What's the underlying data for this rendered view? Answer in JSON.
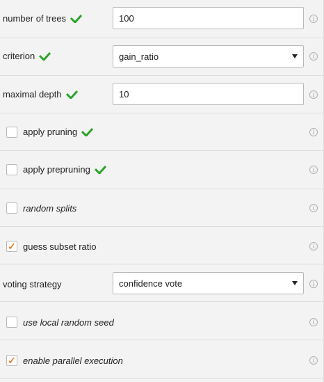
{
  "params": {
    "number_of_trees": {
      "label": "number of trees",
      "value": "100"
    },
    "criterion": {
      "label": "criterion",
      "value": "gain_ratio"
    },
    "maximal_depth": {
      "label": "maximal depth",
      "value": "10"
    },
    "apply_pruning": {
      "label": "apply pruning",
      "checked": false
    },
    "apply_prepruning": {
      "label": "apply prepruning",
      "checked": false
    },
    "random_splits": {
      "label": "random splits",
      "checked": false
    },
    "guess_subset_ratio": {
      "label": "guess subset ratio",
      "checked": true
    },
    "voting_strategy": {
      "label": "voting strategy",
      "value": "confidence vote"
    },
    "use_local_random_seed": {
      "label": "use local random seed",
      "checked": false
    },
    "enable_parallel_execution": {
      "label": "enable parallel execution",
      "checked": true
    }
  },
  "info_glyph": "i",
  "check_glyph": "✓",
  "colors": {
    "accent_check": "#f07d1f",
    "green_check": "#2aa32a"
  }
}
